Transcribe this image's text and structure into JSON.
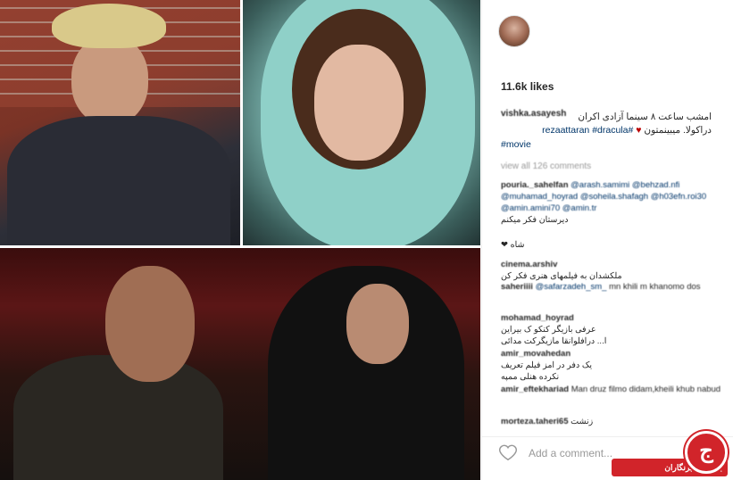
{
  "post": {
    "likes": "11.6k likes",
    "caption_user": "vishka.asayesh",
    "caption_fa": "امشب ساعت ۸ سینما آزادی اکران",
    "caption_fa2": "دراکولا. میبینمتون",
    "caption_tag1": "#rezaattaran",
    "caption_tag2": "#dracula",
    "caption_tag3": "#movie",
    "view_all": "view all 126 comments"
  },
  "comments": [
    {
      "user": "pouria._sahelfan",
      "text": "@arash.samimi @behzad.nfi @muhamad_hoyrad @soheila.shafagh @h03efn.roi30 @amin.amini70 @amin.tr",
      "fa": "دیرستان فکر میکنم"
    },
    {
      "user": "",
      "text": "",
      "fa": "شاه ❤"
    },
    {
      "user": "cinema.arshiv",
      "text": "",
      "fa": "ملکشدان به فیلمهای هنری فکر کن"
    },
    {
      "user": "saheriiii",
      "text": "@safarzadeh_sm_",
      "extra": "mn khili m khanomo dos"
    },
    {
      "user": "mohamad_hoyrad",
      "text": "",
      "fa": "عرفی بازیگر کنکو ک بیراین"
    },
    {
      "user": "",
      "text": "",
      "fa": "ا... درافلوانقا مازیگرکت مدائی"
    },
    {
      "user": "amir_movahedan",
      "text": "",
      "fa": "یک دفر در امز فیلم تعریف"
    },
    {
      "user": "",
      "text": "",
      "fa": "نکرده هنلی ممپه"
    },
    {
      "user": "amir_eftekhariad",
      "text": "Man druz filmo didam,kheili khub nabud"
    },
    {
      "user": "morteza.taheri65",
      "text": "",
      "fa": "زنشت"
    }
  ],
  "input": {
    "placeholder": "Add a comment..."
  },
  "watermark": {
    "label": "باشگاه خبرنگاران",
    "glyph": "ج"
  },
  "colors": {
    "link": "#003569",
    "brand_red": "#d1242a"
  }
}
